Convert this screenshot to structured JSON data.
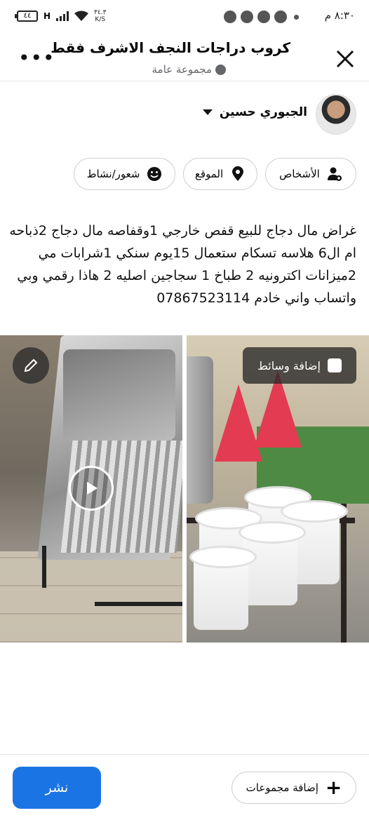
{
  "status_bar": {
    "time": "٨:٣٠ م",
    "battery": "٤٤",
    "speed_value": "٣٤.٣",
    "speed_unit": "K/S",
    "network": "H"
  },
  "header": {
    "title": "كروب دراجات النجف الاشرف فقط",
    "subtitle": "مجموعة عامة",
    "close_icon": "close-icon",
    "more_icon": "more-icon"
  },
  "author": {
    "name": "الجبوري حسين"
  },
  "chips": {
    "people": "الأشخاص",
    "location": "الموقع",
    "feeling": "شعور/نشاط"
  },
  "post": {
    "text": "غراض مال دجاج للبيع قفص خارجي 1وقفاصه مال دجاج 2ذباحه ام ال6 هلاسه تسكام ستعمال 15يوم سنكي 1شرابات مي 2ميزانات اكترونيه 2 طباخ 1 سجاجين اصليه 2 هاذا رقمي وبي واتساب واني خادم 07867523114"
  },
  "media": {
    "add_media_label": "إضافة وسائط"
  },
  "footer": {
    "add_groups_label": "إضافة مجموعات",
    "publish_label": "نشر"
  },
  "colors": {
    "accent": "#1b74e4",
    "border": "#ced0d4",
    "secondary_text": "#65676b"
  }
}
